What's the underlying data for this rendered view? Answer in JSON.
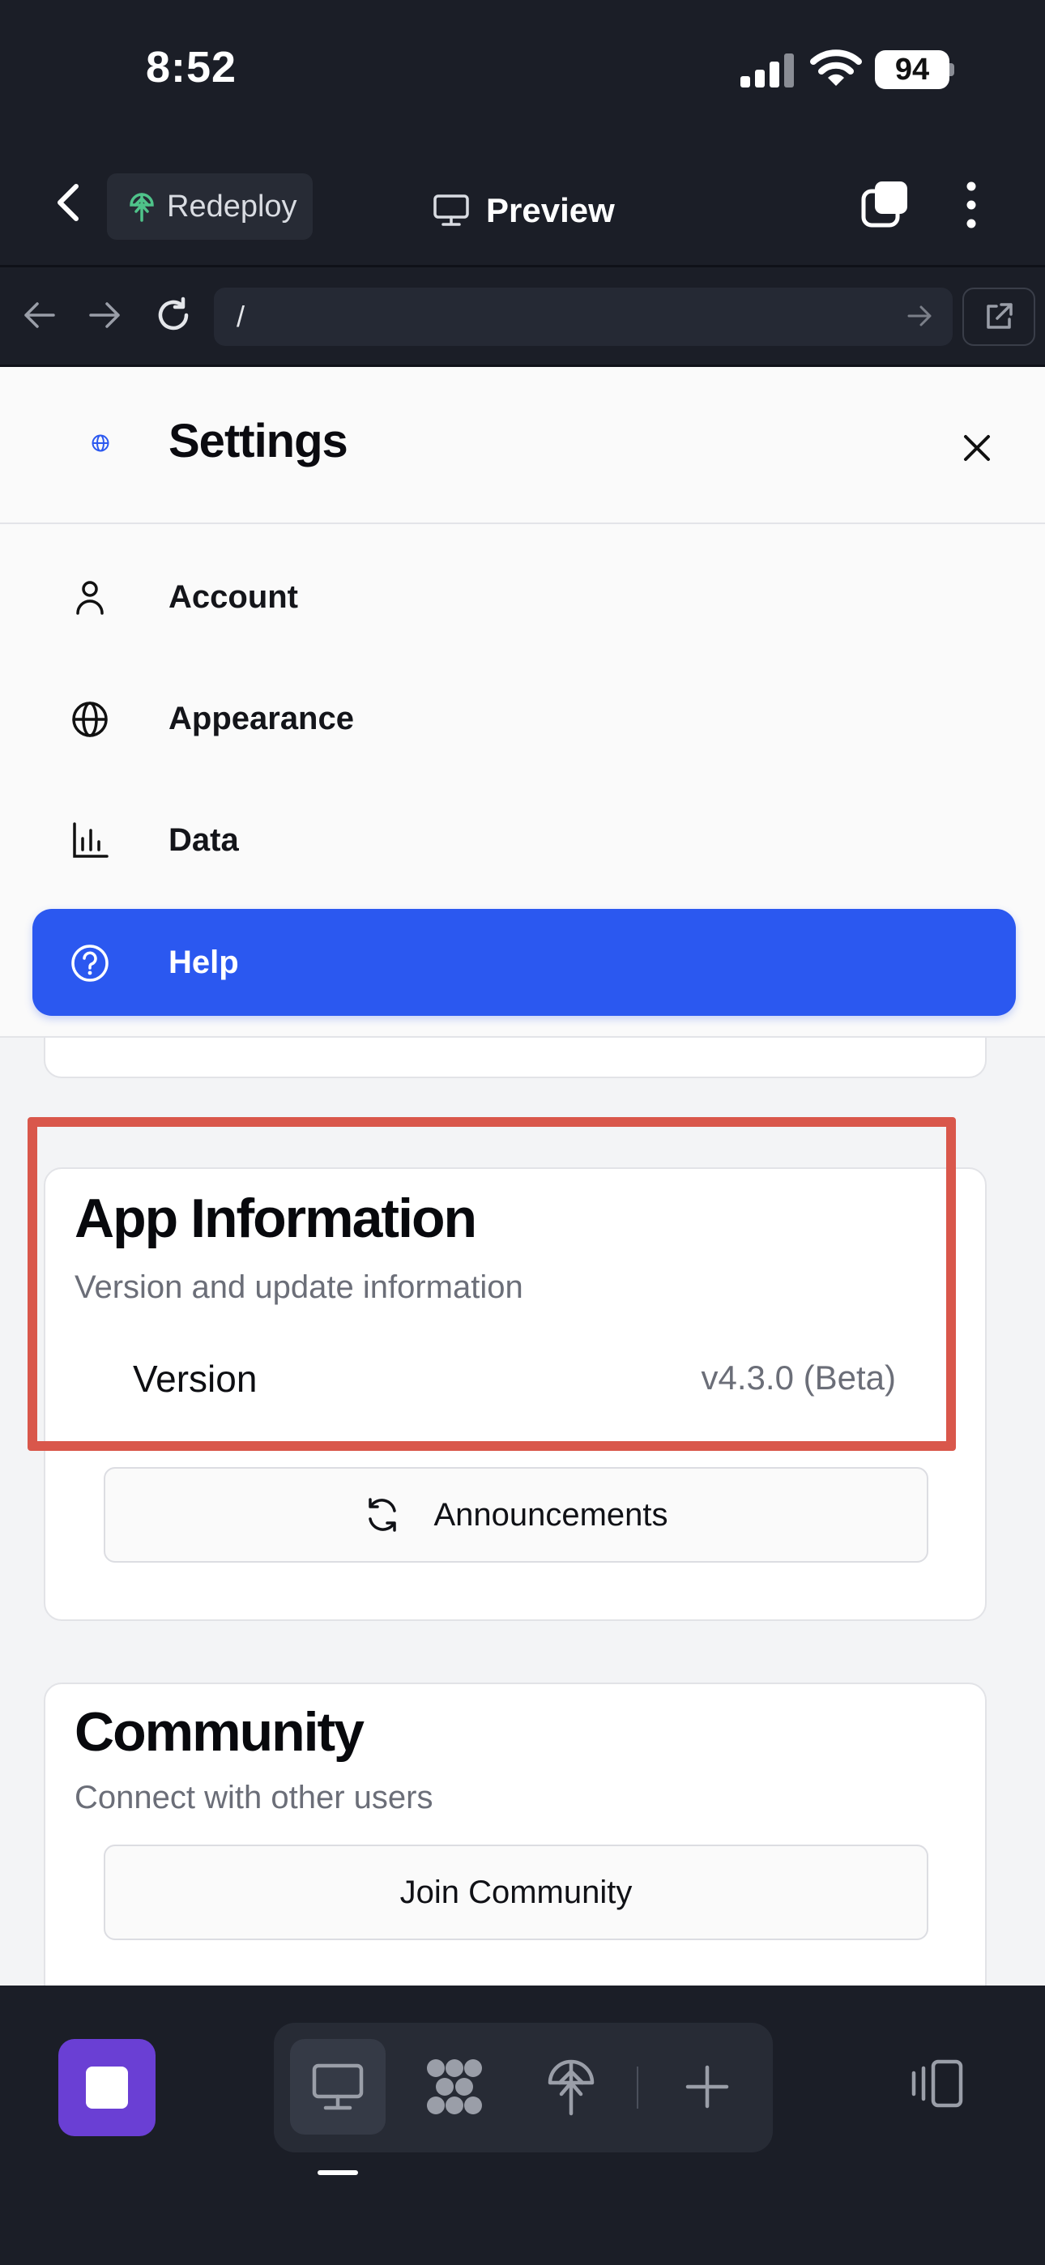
{
  "status_bar": {
    "time": "8:52",
    "battery": "94"
  },
  "header": {
    "redeploy_label": "Redeploy",
    "preview_label": "Preview"
  },
  "browser": {
    "url": "/"
  },
  "settings": {
    "title": "Settings",
    "menu": [
      {
        "label": "Account",
        "icon": "user-icon"
      },
      {
        "label": "Appearance",
        "icon": "globe-icon"
      },
      {
        "label": "Data",
        "icon": "bar-chart-icon"
      },
      {
        "label": "Help",
        "icon": "help-circle-icon",
        "active": true
      }
    ]
  },
  "app_info": {
    "title": "App Information",
    "subtitle": "Version and update information",
    "version_label": "Version",
    "version_value": "v4.3.0 (Beta)",
    "announcements_label": "Announcements"
  },
  "community": {
    "title": "Community",
    "subtitle": "Connect with other users",
    "join_label": "Join Community"
  },
  "colors": {
    "accent": "#2b58f0",
    "highlight": "#d9574b",
    "stop_button": "#6a3fd4",
    "chrome_bg": "#1b1e27"
  }
}
